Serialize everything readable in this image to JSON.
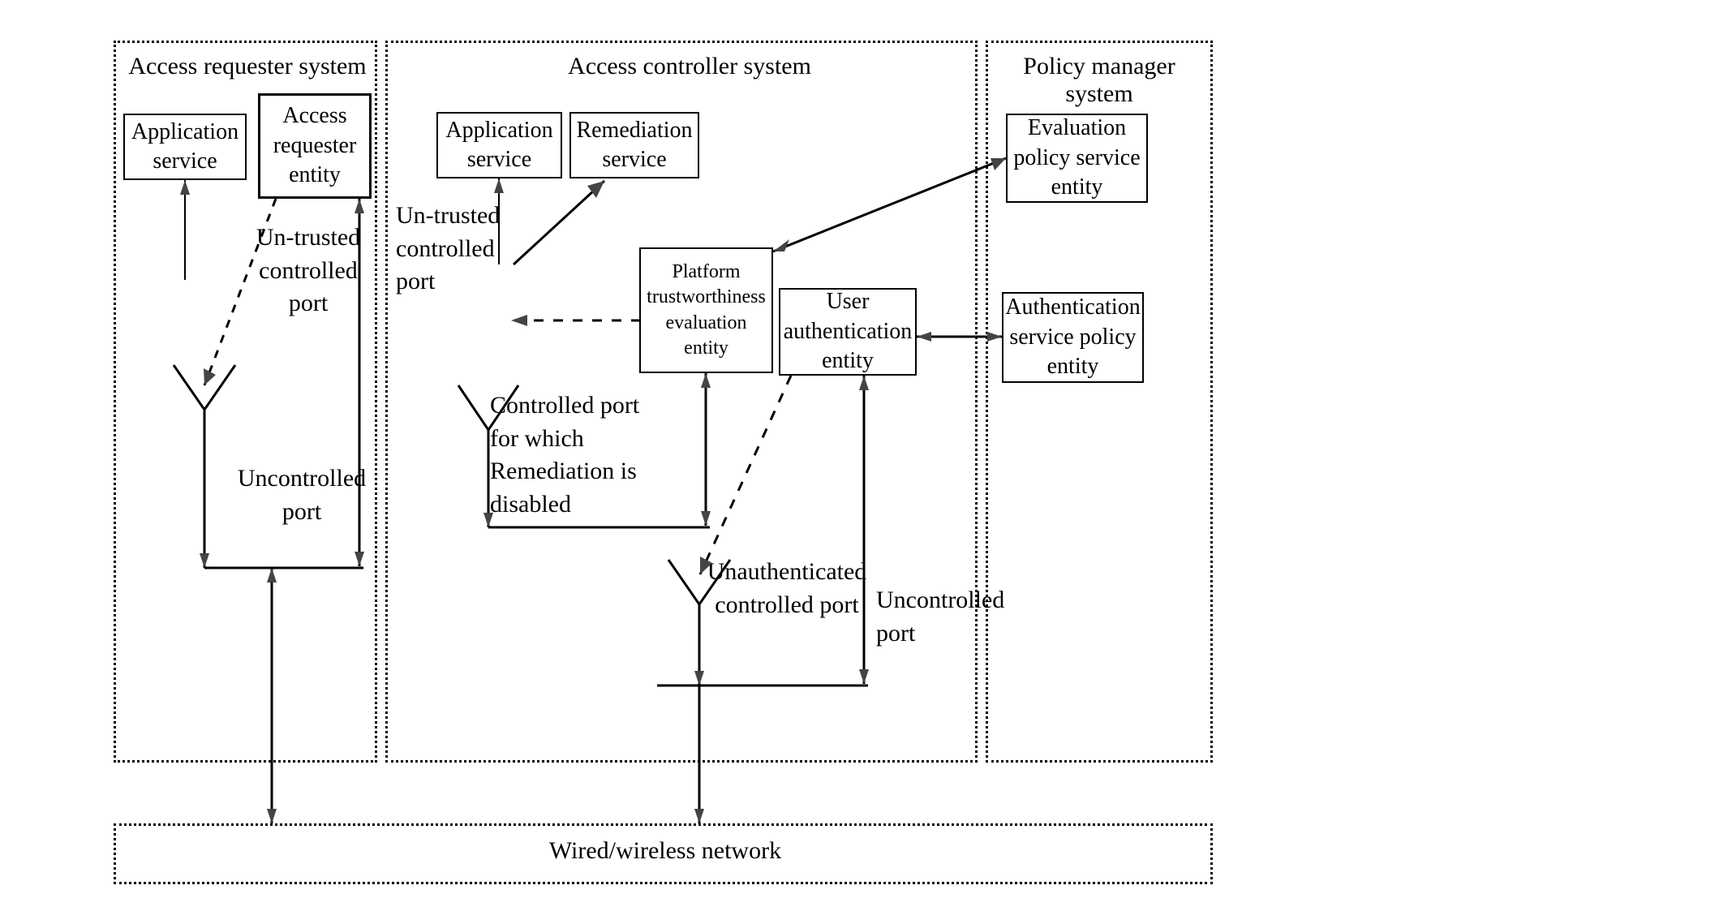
{
  "systems": {
    "requester": {
      "title": "Access requester system"
    },
    "controller": {
      "title": "Access controller system"
    },
    "policy": {
      "title": "Policy manager system"
    }
  },
  "boxes": {
    "app_service_left": "Application service",
    "access_requester_entity": "Access requester entity",
    "app_service_mid": "Application service",
    "remediation_service": "Remediation service",
    "platform_trustworthiness": "Platform trustworthiness evaluation entity",
    "user_authentication": "User authentication entity",
    "evaluation_policy": "Evaluation policy service entity",
    "authentication_service_policy": "Authentication service policy entity"
  },
  "labels": {
    "un_trusted_controlled_port_left": "Un-trusted controlled port",
    "uncontrolled_port_left": "Uncontrolled port",
    "un_trusted_controlled_port_mid": "Un-trusted controlled port",
    "controlled_port_remediation": "Controlled port for which Remediation is disabled",
    "unauthenticated_controlled_port": "Unauthenticated controlled port",
    "uncontrolled_port_right": "Uncontrolled port"
  },
  "network": {
    "title": "Wired/wireless network"
  }
}
